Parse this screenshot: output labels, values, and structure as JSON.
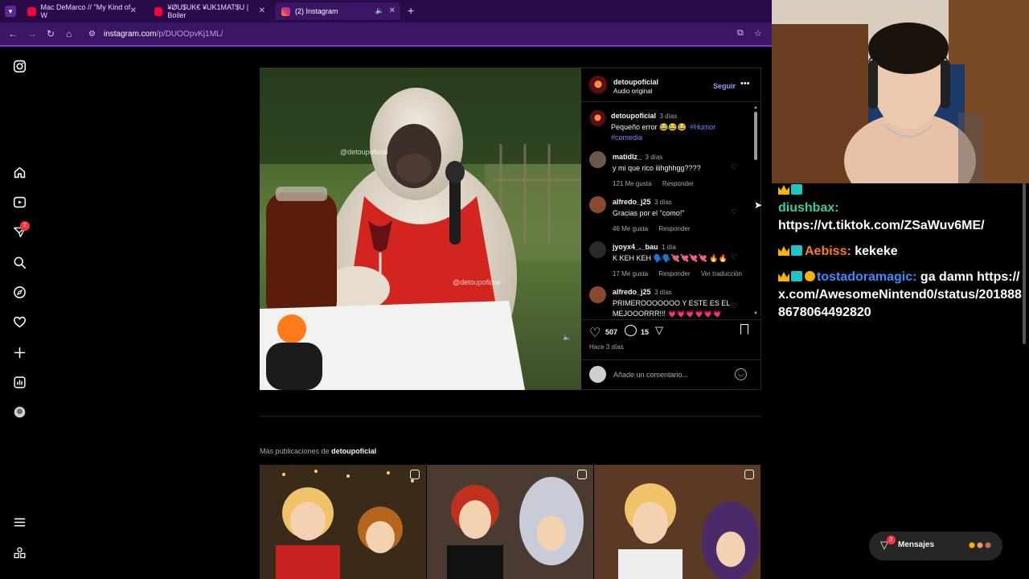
{
  "browser": {
    "tabs": [
      {
        "title": "Mac DeMarco // \"My Kind of W",
        "icon": "youtube-icon",
        "color": "#ff0033"
      },
      {
        "title": "¥ØU$UK€ ¥UK1MAT$U | Boiler",
        "icon": "youtube-icon",
        "color": "#ff0033"
      },
      {
        "title": "(2) Instagram",
        "icon": "instagram-icon",
        "color": "#e1306c"
      }
    ],
    "url_host": "instagram.com",
    "url_path": "/p/DUOOpvKj1ML/"
  },
  "ig": {
    "nav_badge": "2",
    "post": {
      "author": "detoupoficial",
      "audio": "Audio original",
      "follow": "Seguir",
      "watermark": "@detoupoficial",
      "caption": {
        "author": "detoupoficial",
        "time": "3 días",
        "text": "Pequeño error 😂😂😂",
        "tags1": "#Humor",
        "tags2": "#comedia"
      },
      "comments": [
        {
          "user": "matidlz_",
          "time": "3 días",
          "text": "y mi que rico iiihghhgg????",
          "likes": "121 Me gusta",
          "reply": "Responder",
          "extra": ""
        },
        {
          "user": "alfredo_j25",
          "time": "3 días",
          "text": "Gracias por el \"como!\"",
          "likes": "46 Me gusta",
          "reply": "Responder",
          "extra": ""
        },
        {
          "user": "jyoyx4_._bau",
          "time": "1 día",
          "text": "K KEH KEH 🗣️🗣️💘💘💘💘 🔥🔥",
          "likes": "17 Me gusta",
          "reply": "Responder",
          "extra": "Ver traducción"
        },
        {
          "user": "alfredo_j25",
          "time": "3 días",
          "text": "PRIMEROOOOOOO Y ESTE ES EL MEJOOORRR!!! 💗💗💗💗💗💗",
          "likes": "",
          "reply": "",
          "extra": ""
        }
      ],
      "likes_count": "507",
      "comments_count": "15",
      "posted": "Hace 3 días",
      "add_comment_placeholder": "Añade un comentario..."
    },
    "more_from_prefix": "Más publicaciones de",
    "more_from_user": "detoupoficial",
    "messages_label": "Mensajes",
    "messages_badge": "2"
  },
  "chat": {
    "lines": [
      {
        "user": "diushbax:",
        "user_color": "#2fd09a",
        "text": "https://vt.tiktok.com/ZSaWuv6ME/"
      },
      {
        "user": "Aebiss:",
        "user_color": "#ff7a1a",
        "text": "kekeke"
      },
      {
        "user": "tostadoramagic:",
        "user_color": "#3b8cff",
        "text": "ga damn https://x.com/AwesomeNintend0/status/2018888678064492820"
      }
    ]
  }
}
